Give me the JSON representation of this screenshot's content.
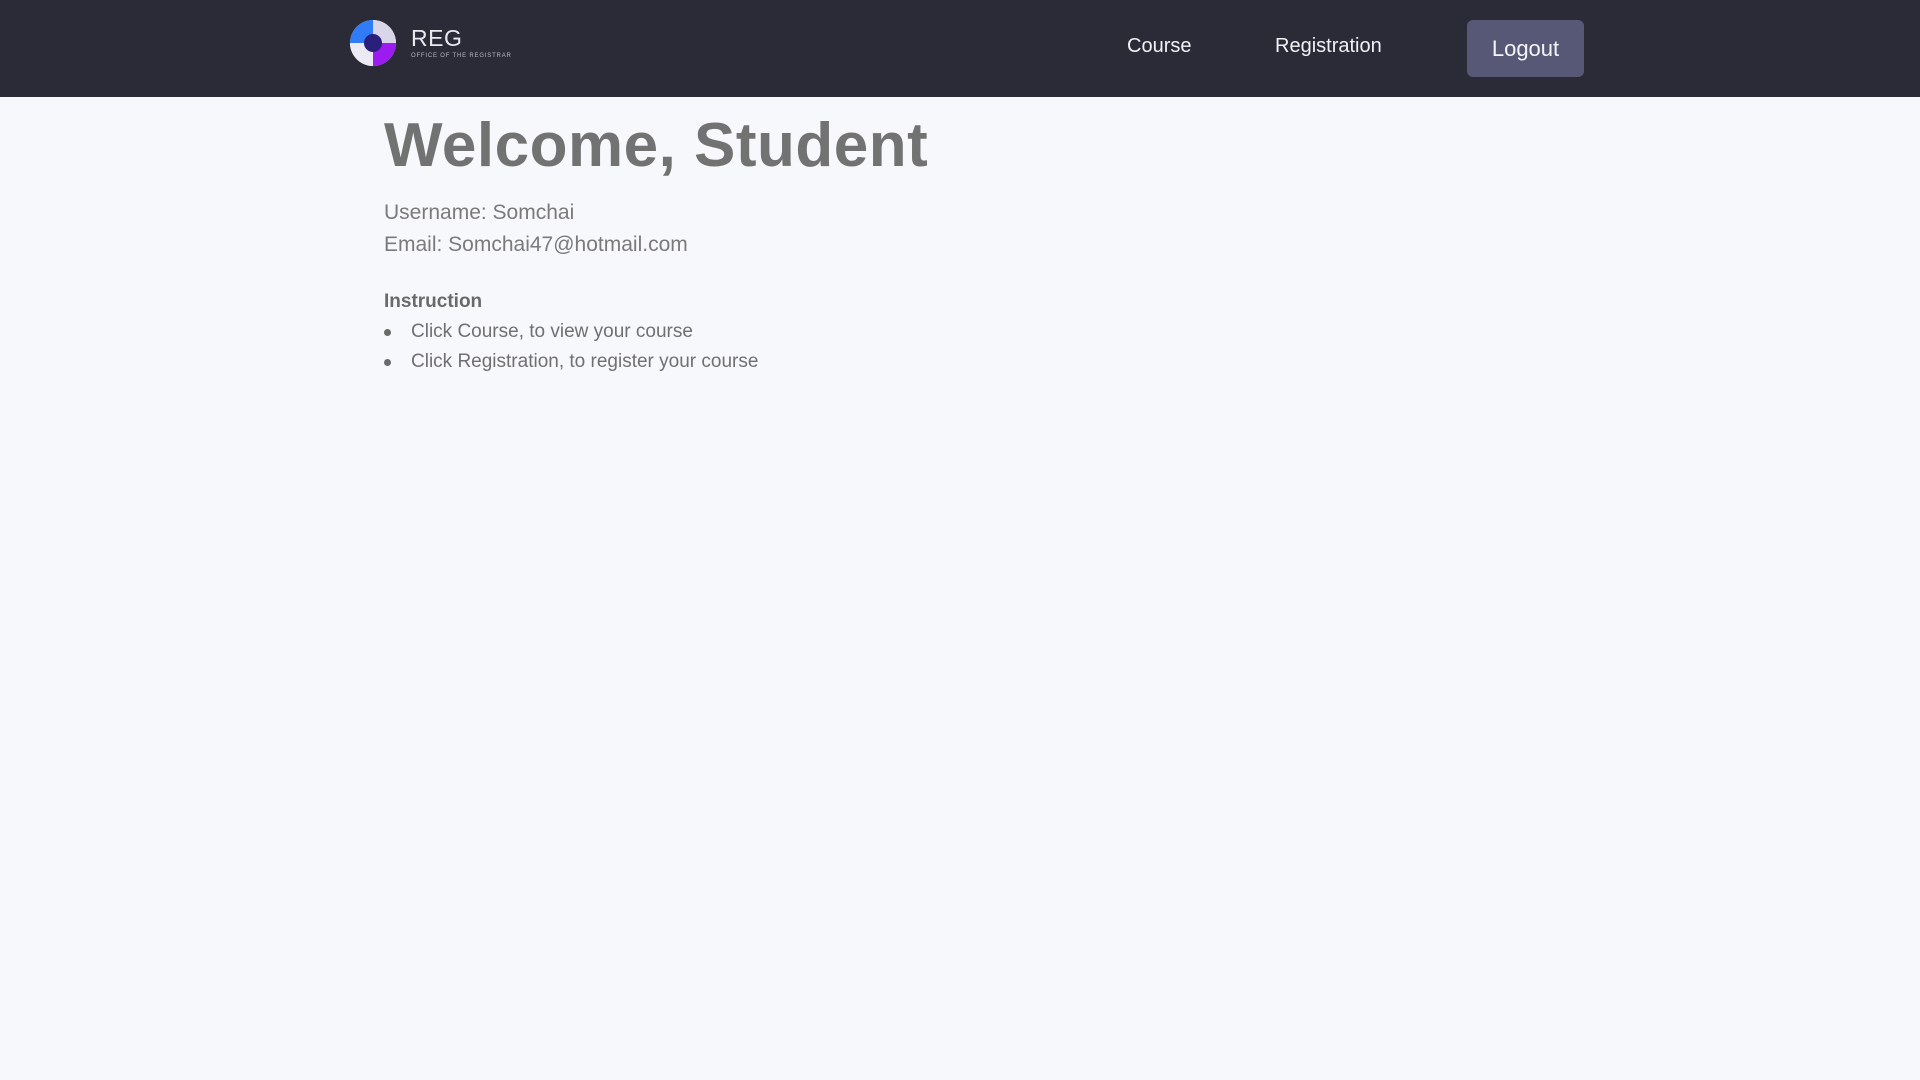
{
  "header": {
    "brand": {
      "title": "REG",
      "subtitle": "OFFICE OF THE REGISTRAR"
    },
    "nav": {
      "course_label": "Course",
      "registration_label": "Registration"
    },
    "logout_label": "Logout"
  },
  "main": {
    "title": "Welcome, Student",
    "username_line": "Username: Somchai",
    "email_line": "Email: Somchai47@hotmail.com",
    "instruction": {
      "heading": "Instruction",
      "items": [
        "Click Course, to view your course",
        "Click Registration, to register your course"
      ]
    }
  },
  "colors": {
    "navbar_bg": "#2b2b38",
    "logout_bg": "#575875",
    "page_bg": "#f7f8fc",
    "logo_blue": "#2f7cf6",
    "logo_purple": "#9b1bf0"
  },
  "icons": {
    "logo": "reg-logo-icon",
    "bullet": "bullet-icon"
  }
}
